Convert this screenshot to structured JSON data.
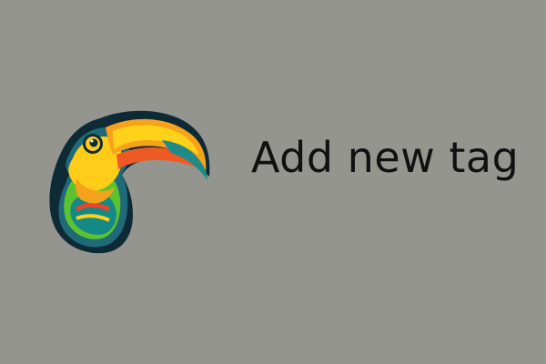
{
  "tile": {
    "label": "Add new tag",
    "icon": "toucan-logo",
    "colors": {
      "background": "#94958f",
      "text": "#111111",
      "outline": "#0e2a35",
      "beak_orange": "#f7a21b",
      "beak_yellow": "#ffd21a",
      "beak_red": "#ee5a24",
      "beak_teal": "#1f8a8a",
      "head_dark": "#1e6a78",
      "chest_yellow": "#ffcc1a",
      "feather_green": "#5cc22f",
      "feather_teal": "#138a86",
      "feather_red": "#e8452b"
    }
  }
}
